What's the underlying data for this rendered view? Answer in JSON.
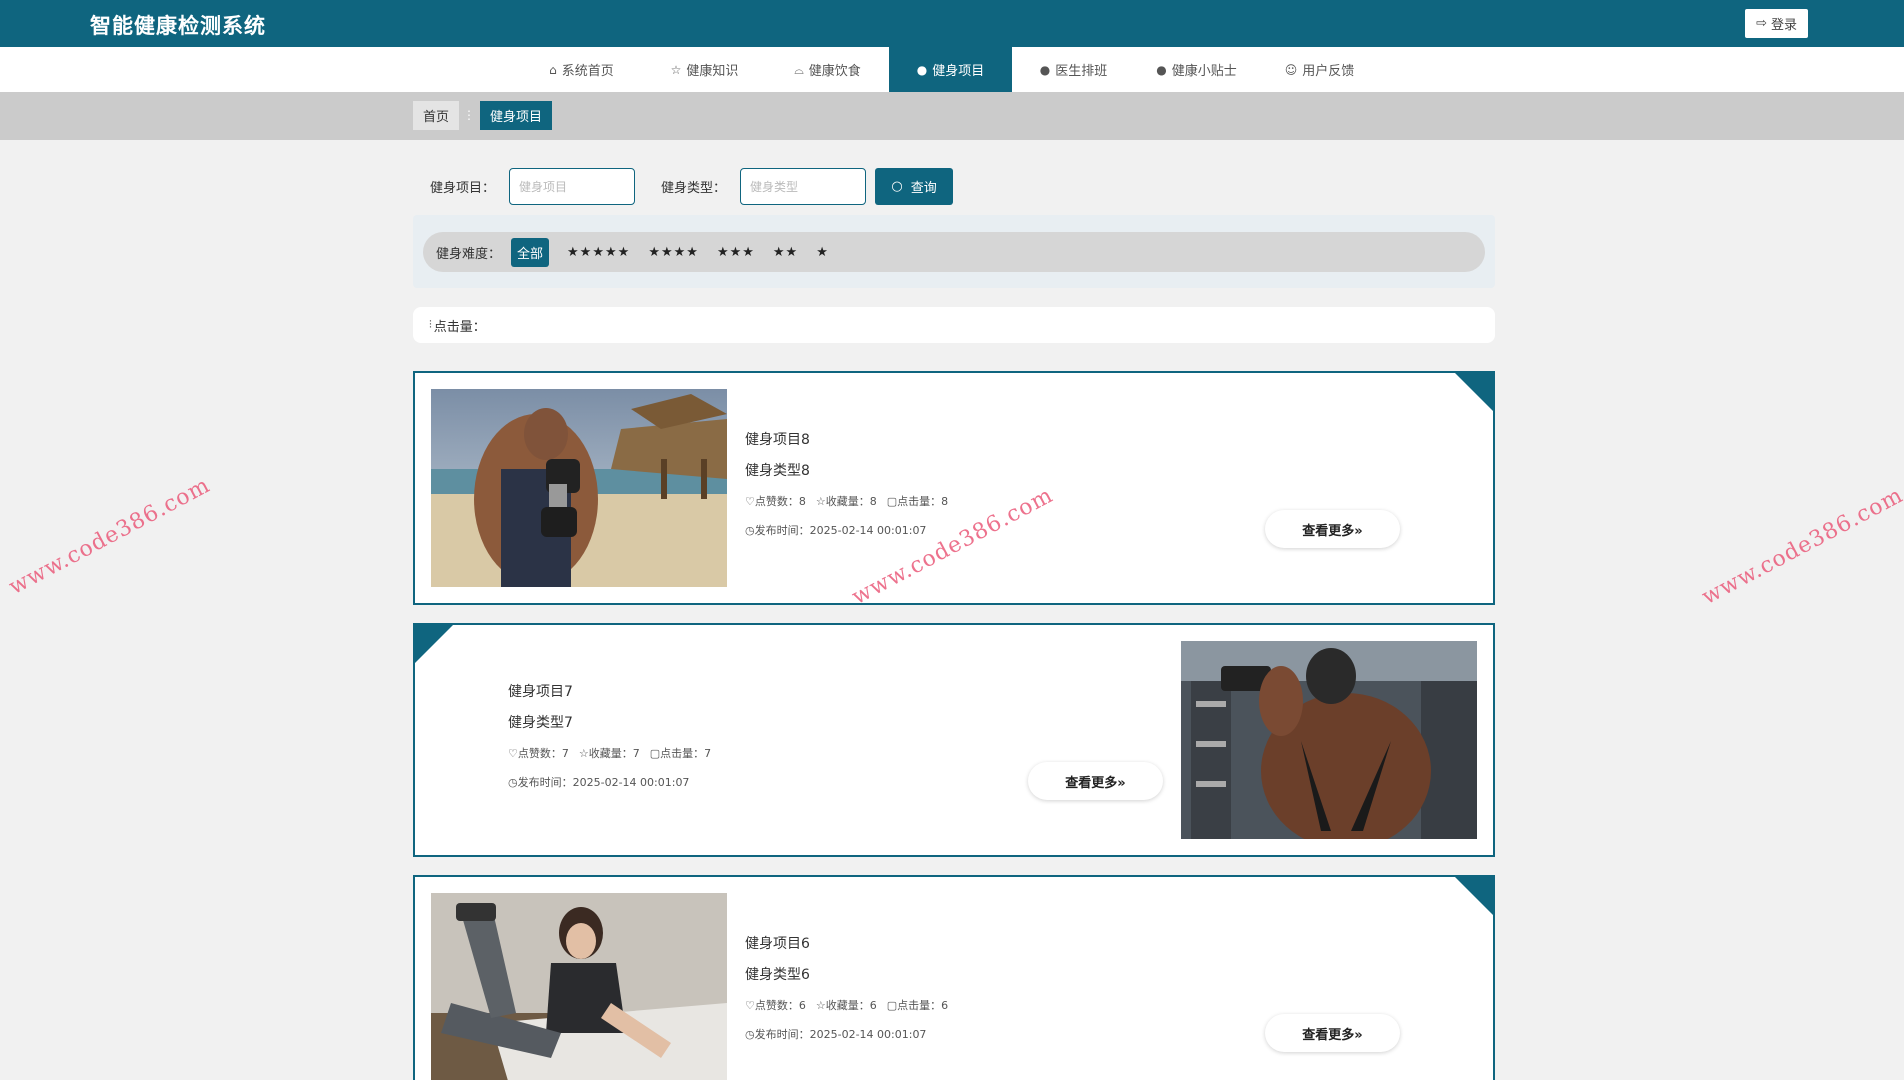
{
  "header": {
    "title": "智能健康检测系统",
    "login_label": "登录"
  },
  "nav": {
    "items": [
      {
        "label": "系统首页",
        "icon": "home-icon"
      },
      {
        "label": "健康知识",
        "icon": "star-icon"
      },
      {
        "label": "健康饮食",
        "icon": "bag-icon"
      },
      {
        "label": "健身项目",
        "icon": "info-icon",
        "active": true
      },
      {
        "label": "医生排班",
        "icon": "question-icon"
      },
      {
        "label": "健康小贴士",
        "icon": "info-icon"
      },
      {
        "label": "用户反馈",
        "icon": "smile-icon"
      }
    ]
  },
  "breadcrumb": {
    "home": "首页",
    "separator": "⋮",
    "current": "健身项目"
  },
  "search": {
    "project_label": "健身项目：",
    "project_placeholder": "健身项目",
    "type_label": "健身类型：",
    "type_placeholder": "健身类型",
    "button_label": "查询"
  },
  "filter": {
    "label": "健身难度：",
    "options": [
      "全部",
      "★★★★★",
      "★★★★",
      "★★★",
      "★★",
      "★"
    ],
    "selected": "全部"
  },
  "sort": {
    "label": "点击量："
  },
  "cards": [
    {
      "title": "健身项目8",
      "type": "健身类型8",
      "likes": "点赞数：8",
      "favorites": "收藏量：8",
      "clicks": "点击量：8",
      "time": "发布时间：2025-02-14 00:01:07",
      "more": "查看更多»"
    },
    {
      "title": "健身项目7",
      "type": "健身类型7",
      "likes": "点赞数：7",
      "favorites": "收藏量：7",
      "clicks": "点击量：7",
      "time": "发布时间：2025-02-14 00:01:07",
      "more": "查看更多»"
    },
    {
      "title": "健身项目6",
      "type": "健身类型6",
      "likes": "点赞数：6",
      "favorites": "收藏量：6",
      "clicks": "点击量：6",
      "time": "发布时间：2025-02-14 00:01:07",
      "more": "查看更多»"
    }
  ],
  "watermark": "www.code386.com",
  "colors": {
    "primary": "#0f657f",
    "background": "#f1f1f1",
    "watermark": "#ea5a7a"
  }
}
